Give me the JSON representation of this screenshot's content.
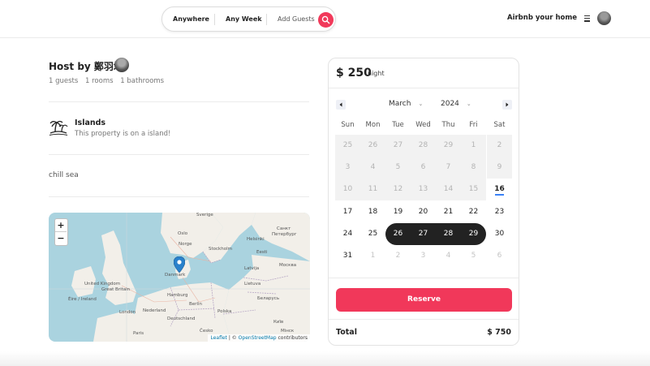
{
  "header": {
    "search": {
      "anywhere": "Anywhere",
      "any_week": "Any Week",
      "add_guests": "Add Guests"
    },
    "host_link": "Airbnb your home"
  },
  "listing": {
    "host_title": "Host by 鄭羽均",
    "meta": {
      "guests": "1 guests",
      "rooms": "1 rooms",
      "bathrooms": "1 bathrooms"
    },
    "category": {
      "title": "Islands",
      "description": "This property is on a island!"
    },
    "description": "chill sea"
  },
  "map": {
    "zoom_in": "+",
    "zoom_out": "−",
    "attribution": {
      "leaflet": "Leaflet",
      "separator": " | © ",
      "osm": "OpenStreetMap",
      "suffix": " contributors"
    },
    "labels": {
      "sverige": "Sverige",
      "oslo": "Oslo",
      "norge": "Norge",
      "stockholm": "Stockholm",
      "helsinki": "Helsinki",
      "st_petersburg_1": "Санкт",
      "st_petersburg_2": "Петербург",
      "eesti": "Eesti",
      "latvija": "Latvija",
      "lietuva": "Lietuva",
      "danmark": "Danmark",
      "uk_1": "United Kingdom",
      "great_britain": "Great Britain",
      "eire": "Éire / Ireland",
      "london": "London",
      "nederland": "Nederland",
      "hamburg": "Hamburg",
      "berlin": "Berlin",
      "deutschland": "Deutschland",
      "polska": "Polska",
      "paris": "Paris",
      "cesko": "Česko",
      "moskva": "Москва",
      "belarus": "Беларусь",
      "kyiv": "Київ",
      "minsk": "Мінск"
    }
  },
  "booking": {
    "price": "$ 250",
    "price_unit": "night",
    "calendar": {
      "month": "March",
      "year": "2024",
      "weekdays": [
        "Sun",
        "Mon",
        "Tue",
        "Wed",
        "Thu",
        "Fri",
        "Sat"
      ],
      "weeks": [
        [
          "25",
          "26",
          "27",
          "28",
          "29",
          "1",
          "2"
        ],
        [
          "3",
          "4",
          "5",
          "6",
          "7",
          "8",
          "9"
        ],
        [
          "10",
          "11",
          "12",
          "13",
          "14",
          "15",
          "16"
        ],
        [
          "17",
          "18",
          "19",
          "20",
          "21",
          "22",
          "23"
        ],
        [
          "24",
          "25",
          "26",
          "27",
          "28",
          "29",
          "30"
        ],
        [
          "31",
          "1",
          "2",
          "3",
          "4",
          "5",
          "6"
        ]
      ],
      "today": "16",
      "selected_range": [
        "26",
        "29"
      ]
    },
    "reserve_label": "Reserve",
    "total_label": "Total",
    "total_value": "$ 750"
  },
  "colors": {
    "accent": "#f1385a",
    "selected": "#222222",
    "today_underline": "#3b82f6",
    "map_water": "#aad3df",
    "marker": "#2a81cb"
  }
}
